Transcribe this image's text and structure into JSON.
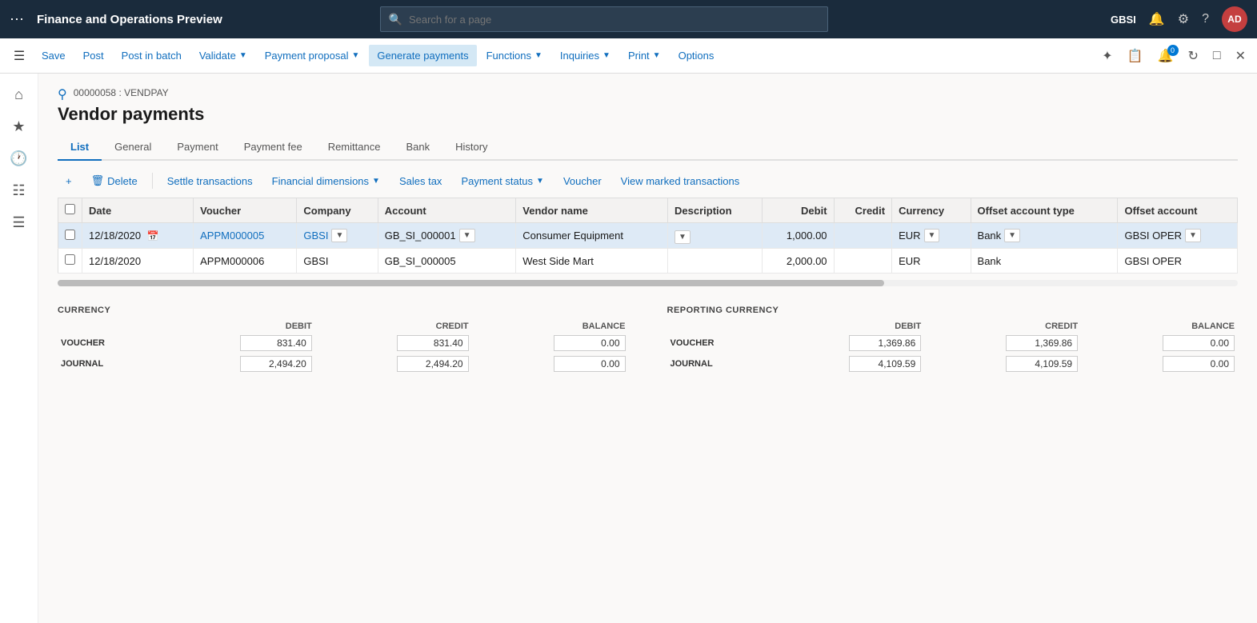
{
  "app": {
    "title": "Finance and Operations Preview",
    "avatar": "AD"
  },
  "search": {
    "placeholder": "Search for a page"
  },
  "topnav_right": {
    "tenant": "GBSI"
  },
  "toolbar": {
    "save": "Save",
    "post": "Post",
    "post_in_batch": "Post in batch",
    "validate": "Validate",
    "payment_proposal": "Payment proposal",
    "generate_payments": "Generate payments",
    "functions": "Functions",
    "inquiries": "Inquiries",
    "print": "Print",
    "options": "Options"
  },
  "breadcrumb": "00000058 : VENDPAY",
  "page_title": "Vendor payments",
  "tabs": [
    {
      "label": "List",
      "active": true
    },
    {
      "label": "General"
    },
    {
      "label": "Payment"
    },
    {
      "label": "Payment fee"
    },
    {
      "label": "Remittance"
    },
    {
      "label": "Bank"
    },
    {
      "label": "History"
    }
  ],
  "sub_toolbar": {
    "new": "+ New",
    "delete": "Delete",
    "settle_transactions": "Settle transactions",
    "financial_dimensions": "Financial dimensions",
    "sales_tax": "Sales tax",
    "payment_status": "Payment status",
    "voucher": "Voucher",
    "view_marked": "View marked transactions"
  },
  "grid": {
    "columns": [
      {
        "key": "check",
        "label": ""
      },
      {
        "key": "date",
        "label": "Date"
      },
      {
        "key": "voucher",
        "label": "Voucher"
      },
      {
        "key": "company",
        "label": "Company"
      },
      {
        "key": "account",
        "label": "Account"
      },
      {
        "key": "vendor_name",
        "label": "Vendor name"
      },
      {
        "key": "description",
        "label": "Description"
      },
      {
        "key": "debit",
        "label": "Debit",
        "align": "right"
      },
      {
        "key": "credit",
        "label": "Credit",
        "align": "right"
      },
      {
        "key": "currency",
        "label": "Currency"
      },
      {
        "key": "offset_account_type",
        "label": "Offset account type"
      },
      {
        "key": "offset_account",
        "label": "Offset account"
      }
    ],
    "rows": [
      {
        "selected": true,
        "date": "12/18/2020",
        "voucher": "APPM000005",
        "company": "GBSI",
        "account": "GB_SI_000001",
        "vendor_name": "Consumer Equipment",
        "description": "",
        "debit": "1,000.00",
        "credit": "",
        "currency": "EUR",
        "offset_account_type": "Bank",
        "offset_account": "GBSI OPER"
      },
      {
        "selected": false,
        "date": "12/18/2020",
        "voucher": "APPM000006",
        "company": "GBSI",
        "account": "GB_SI_000005",
        "vendor_name": "West Side Mart",
        "description": "",
        "debit": "2,000.00",
        "credit": "",
        "currency": "EUR",
        "offset_account_type": "Bank",
        "offset_account": "GBSI OPER"
      }
    ]
  },
  "summary": {
    "currency_title": "CURRENCY",
    "reporting_title": "REPORTING CURRENCY",
    "col_debit": "DEBIT",
    "col_credit": "CREDIT",
    "col_balance": "BALANCE",
    "rows": [
      {
        "label": "VOUCHER",
        "cur_debit": "831.40",
        "cur_credit": "831.40",
        "cur_balance": "0.00",
        "rep_debit": "1,369.86",
        "rep_credit": "1,369.86",
        "rep_balance": "0.00"
      },
      {
        "label": "JOURNAL",
        "cur_debit": "2,494.20",
        "cur_credit": "2,494.20",
        "cur_balance": "0.00",
        "rep_debit": "4,109.59",
        "rep_credit": "4,109.59",
        "rep_balance": "0.00"
      }
    ]
  }
}
